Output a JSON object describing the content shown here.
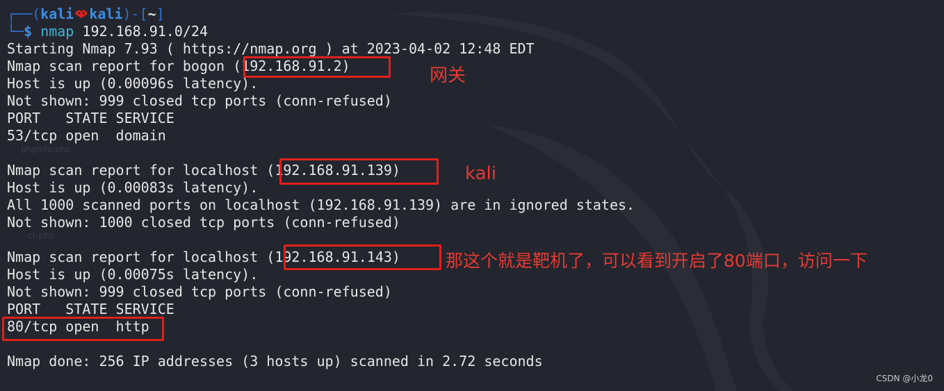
{
  "prompt": {
    "frame_top": "┌──(",
    "user": "kali",
    "host": "kali",
    "close": ")-[",
    "dir": "~",
    "end": "]",
    "frame_bottom": "└─",
    "dollar": "$",
    "command": "nmap",
    "args": " 192.168.91.0/24"
  },
  "output": {
    "start": "Starting Nmap 7.93 ( https://nmap.org ) at 2023-04-02 12:48 EDT",
    "r1_prefix": "Nmap scan report for bogon ",
    "r1_ip": "(192.168.91.2)",
    "r1_up": "Host is up (0.00096s latency).",
    "r1_notshown": "Not shown: 999 closed tcp ports (conn-refused)",
    "r1_header": "PORT   STATE SERVICE",
    "r1_port": "53/tcp open  domain",
    "r2_prefix": "Nmap scan report for localhost ",
    "r2_ip": "(192.168.91.139)",
    "r2_up": "Host is up (0.00083s latency).",
    "r2_all": "All 1000 scanned ports on localhost (192.168.91.139) are in ignored states.",
    "r2_notshown": "Not shown: 1000 closed tcp ports (conn-refused)",
    "r3_prefix": "Nmap scan report for localhost ",
    "r3_ip": "(192.168.91.143)",
    "r3_up": "Host is up (0.00075s latency).",
    "r3_notshown": "Not shown: 999 closed tcp ports (conn-refused)",
    "r3_header": "PORT   STATE SERVICE",
    "r3_port": "80/tcp open  http",
    "done": "Nmap done: 256 IP addresses (3 hosts up) scanned in 2.72 seconds"
  },
  "annotations": {
    "gateway": "网关",
    "kali": "kali",
    "target": "那这个就是靶机了，可以看到开启了80端口，访问一下"
  },
  "faint_text": {
    "a": "phpinfo.php",
    "b": "ct-php"
  },
  "watermark": "CSDN @小龙0",
  "colors": {
    "background": "#23262e",
    "prompt_blue": "#3b8eea",
    "command_cyan": "#3fb6d6",
    "annotation_red": "#e0201c"
  }
}
